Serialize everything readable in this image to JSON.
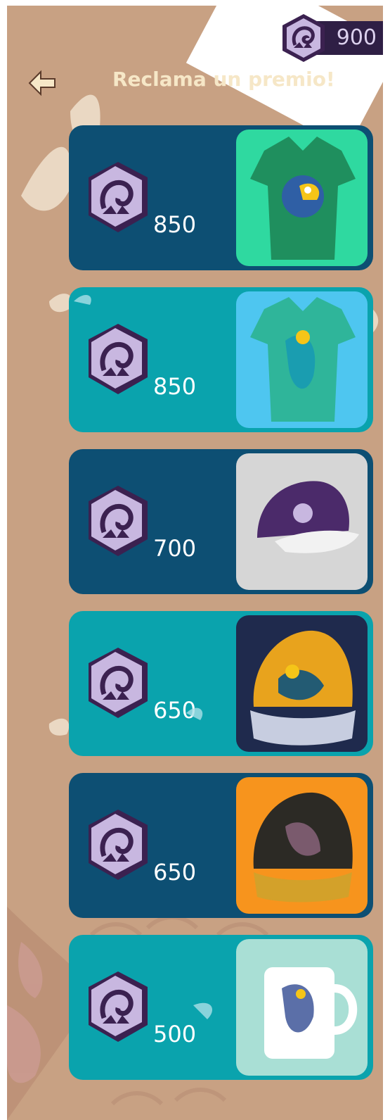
{
  "header": {
    "title": "Reclama un premio!",
    "coin_balance": "900"
  },
  "icons": {
    "back": "arrow-left-icon",
    "coin": "hexagon-coin-icon"
  },
  "colors": {
    "background": "#c8a183",
    "card_dark": "#0d4f73",
    "card_teal": "#0aa3ad",
    "title": "#f6e7c7",
    "coin_purple": "#c8b7e0",
    "coin_dark": "#3b2150"
  },
  "rewards": [
    {
      "price": "850",
      "product": "t-shirt-toucan",
      "thumb_color": "#2fd9a0"
    },
    {
      "price": "850",
      "product": "t-shirt-bird",
      "thumb_color": "#4ec6f0"
    },
    {
      "price": "700",
      "product": "cap-purple",
      "thumb_color": "#d6d6d6"
    },
    {
      "price": "650",
      "product": "cap-yellow-bird",
      "thumb_color": "#1f2a4d"
    },
    {
      "price": "650",
      "product": "cap-brown-bird",
      "thumb_color": "#f7941d"
    },
    {
      "price": "500",
      "product": "mug-bird",
      "thumb_color": "#a9dfd5"
    }
  ]
}
